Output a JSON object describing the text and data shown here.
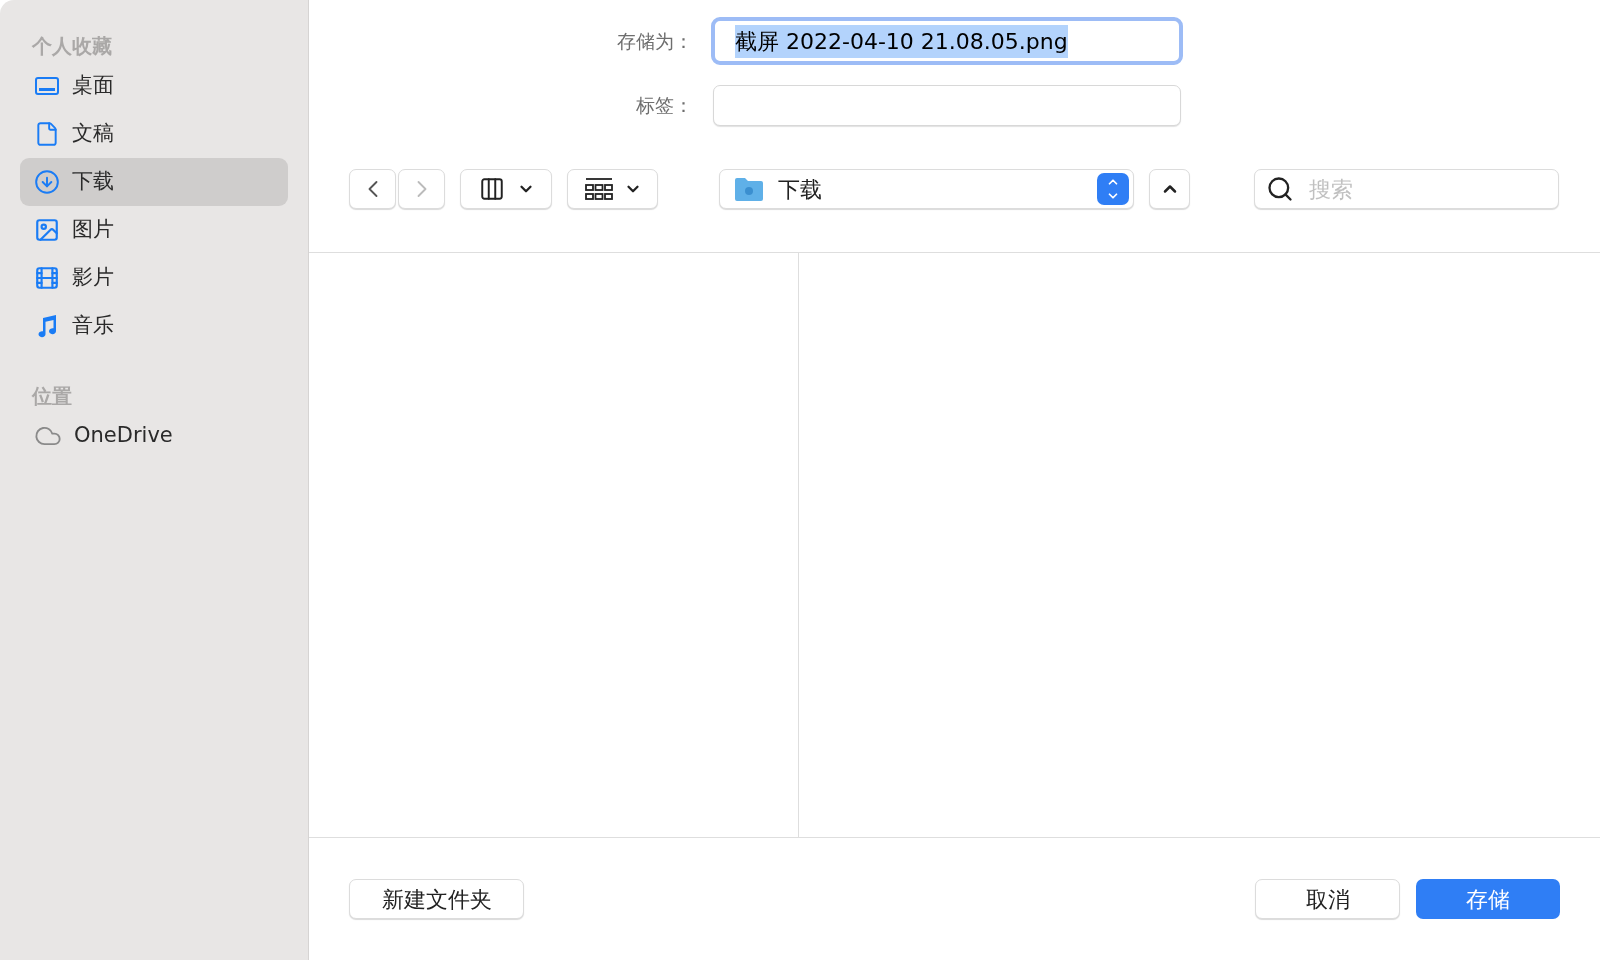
{
  "sidebar": {
    "sections": [
      {
        "title": "个人收藏",
        "items": [
          {
            "kind": "desktop",
            "label": "桌面",
            "selected": false
          },
          {
            "kind": "document",
            "label": "文稿",
            "selected": false
          },
          {
            "kind": "download",
            "label": "下载",
            "selected": true
          },
          {
            "kind": "pictures",
            "label": "图片",
            "selected": false
          },
          {
            "kind": "movies",
            "label": "影片",
            "selected": false
          },
          {
            "kind": "music",
            "label": "音乐",
            "selected": false
          }
        ]
      },
      {
        "title": "位置",
        "items": [
          {
            "kind": "cloud",
            "label": "OneDrive",
            "selected": false
          }
        ]
      }
    ]
  },
  "save_as": {
    "label": "存储为：",
    "value": "截屏 2022-04-10 21.08.05.png",
    "text_selected": true
  },
  "tags": {
    "label": "标签："
  },
  "toolbar": {
    "location": "下载",
    "search_placeholder": "搜索"
  },
  "buttons": {
    "new_folder": "新建文件夹",
    "cancel": "取消",
    "save": "存储"
  }
}
